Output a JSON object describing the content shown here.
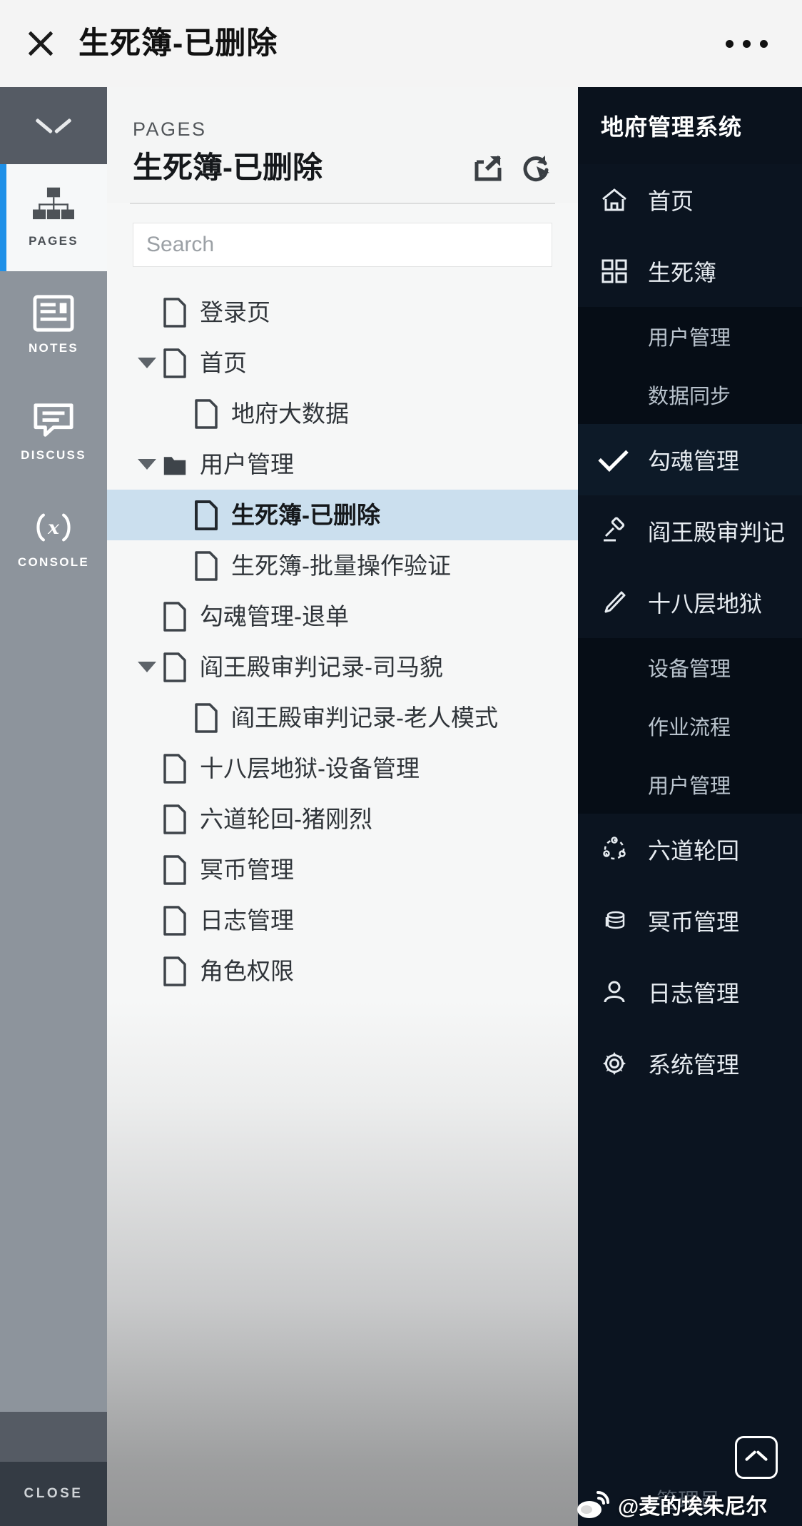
{
  "topbar": {
    "close_icon": "close-icon",
    "title": "生死簿-已删除",
    "more_icon": "more-dots-icon"
  },
  "rail": {
    "collapse_icon": "chevron-down-icon",
    "items": [
      {
        "label": "PAGES",
        "icon": "sitemap-icon",
        "active": true
      },
      {
        "label": "NOTES",
        "icon": "notes-icon",
        "active": false
      },
      {
        "label": "DISCUSS",
        "icon": "discuss-bubble-icon",
        "active": false
      },
      {
        "label": "CONSOLE",
        "icon": "console-fx-icon",
        "active": false
      }
    ],
    "close_label": "CLOSE"
  },
  "pages_panel": {
    "kicker": "PAGES",
    "title": "生死簿-已删除",
    "export_icon": "export-external-icon",
    "refresh_icon": "refresh-cursor-icon",
    "search_placeholder": "Search",
    "search_value": "",
    "tree": [
      {
        "label": "登录页",
        "type": "page",
        "depth": 0,
        "caret": "none",
        "selected": false
      },
      {
        "label": "首页",
        "type": "page",
        "depth": 0,
        "caret": "expanded",
        "selected": false
      },
      {
        "label": "地府大数据",
        "type": "page",
        "depth": 1,
        "caret": "none",
        "selected": false
      },
      {
        "label": "用户管理",
        "type": "folder",
        "depth": 0,
        "caret": "expanded",
        "selected": false
      },
      {
        "label": "生死簿-已删除",
        "type": "page",
        "depth": 1,
        "caret": "none",
        "selected": true
      },
      {
        "label": "生死簿-批量操作验证",
        "type": "page",
        "depth": 1,
        "caret": "none",
        "selected": false
      },
      {
        "label": "勾魂管理-退单",
        "type": "page",
        "depth": 0,
        "caret": "none",
        "selected": false
      },
      {
        "label": "阎王殿审判记录-司马貌",
        "type": "page",
        "depth": 0,
        "caret": "expanded",
        "selected": false
      },
      {
        "label": "阎王殿审判记录-老人模式",
        "type": "page",
        "depth": 1,
        "caret": "none",
        "selected": false
      },
      {
        "label": "十八层地狱-设备管理",
        "type": "page",
        "depth": 0,
        "caret": "none",
        "selected": false
      },
      {
        "label": "六道轮回-猪刚烈",
        "type": "page",
        "depth": 0,
        "caret": "none",
        "selected": false
      },
      {
        "label": "冥币管理",
        "type": "page",
        "depth": 0,
        "caret": "none",
        "selected": false
      },
      {
        "label": "日志管理",
        "type": "page",
        "depth": 0,
        "caret": "none",
        "selected": false
      },
      {
        "label": "角色权限",
        "type": "page",
        "depth": 0,
        "caret": "none",
        "selected": false
      }
    ]
  },
  "admin": {
    "brand": "地府管理系统",
    "menu": [
      {
        "label": "首页",
        "icon": "home-icon"
      },
      {
        "label": "生死簿",
        "icon": "grid-squares-icon",
        "children": [
          {
            "label": "用户管理"
          },
          {
            "label": "数据同步"
          }
        ]
      },
      {
        "label": "勾魂管理",
        "icon": "check-icon",
        "checked": true
      },
      {
        "label": "阎王殿审判记",
        "icon": "gavel-icon"
      },
      {
        "label": "十八层地狱",
        "icon": "knife-icon",
        "children": [
          {
            "label": "设备管理"
          },
          {
            "label": "作业流程"
          },
          {
            "label": "用户管理"
          }
        ]
      },
      {
        "label": "六道轮回",
        "icon": "reincarnation-circle-icon"
      },
      {
        "label": "冥币管理",
        "icon": "coins-icon"
      },
      {
        "label": "日志管理",
        "icon": "user-icon"
      },
      {
        "label": "系统管理",
        "icon": "gear-icon"
      }
    ],
    "user": "管理员",
    "scroll_top_icon": "chevron-up-icon"
  },
  "watermark": {
    "logo": "weibo-icon",
    "text": "@麦的埃朱尼尔"
  },
  "colors": {
    "accent_blue": "#1e90e8",
    "rail_bg": "#8d949c",
    "rail_dark": "#555b64",
    "admin_bg": "#0b1420",
    "selected_row": "#cbdfee"
  }
}
